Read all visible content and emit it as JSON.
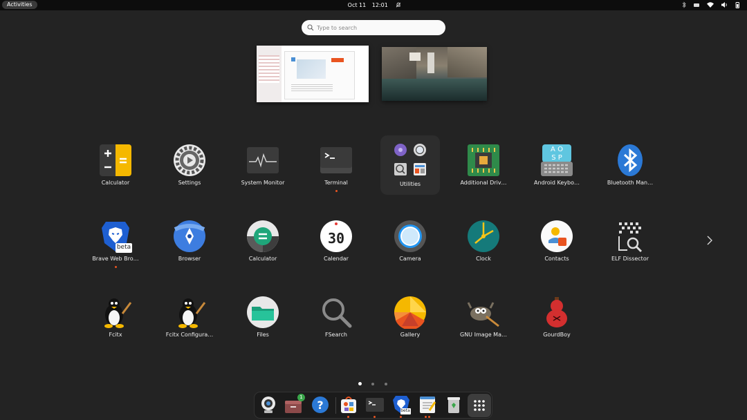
{
  "topbar": {
    "activities": "Activities",
    "date": "Oct 11",
    "time": "12:01"
  },
  "search": {
    "placeholder": "Type to search"
  },
  "apps": [
    {
      "label": "Calculator",
      "icon": "calculator-icon"
    },
    {
      "label": "Settings",
      "icon": "settings-gear-icon"
    },
    {
      "label": "System Monitor",
      "icon": "system-monitor-icon"
    },
    {
      "label": "Terminal",
      "icon": "terminal-icon",
      "running": true
    },
    {
      "label": "Utilities",
      "icon": "utilities-folder-icon"
    },
    {
      "label": "Additional Driv…",
      "icon": "chip-icon"
    },
    {
      "label": "Android Keybo…",
      "icon": "keyboard-icon"
    },
    {
      "label": "Bluetooth Man…",
      "icon": "bluetooth-icon"
    },
    {
      "label": "Brave Web Bro…",
      "icon": "brave-lion-icon",
      "running": true
    },
    {
      "label": "Browser",
      "icon": "browser-compass-icon"
    },
    {
      "label": "Calculator",
      "icon": "calculator-equals-icon"
    },
    {
      "label": "Calendar",
      "icon": "calendar-icon"
    },
    {
      "label": "Camera",
      "icon": "camera-icon"
    },
    {
      "label": "Clock",
      "icon": "clock-icon"
    },
    {
      "label": "Contacts",
      "icon": "contacts-icon"
    },
    {
      "label": "ELF Dissector",
      "icon": "elf-dissector-icon"
    },
    {
      "label": "Fcitx",
      "icon": "tux-penguin-icon"
    },
    {
      "label": "Fcitx Configura…",
      "icon": "tux-penguin-icon"
    },
    {
      "label": "Files",
      "icon": "folder-icon"
    },
    {
      "label": "FSearch",
      "icon": "magnifier-icon"
    },
    {
      "label": "Gallery",
      "icon": "gallery-icon"
    },
    {
      "label": "GNU Image Ma…",
      "icon": "gimp-icon"
    },
    {
      "label": "GourdBoy",
      "icon": "gourd-icon"
    }
  ],
  "calendar_day": "30",
  "brave_badge": "beta",
  "pager": {
    "pages": 3,
    "current": 1
  },
  "dock": {
    "files_badge": "1",
    "brave_badge": "beta",
    "items": [
      "cheese-webcam-icon",
      "files-cabinet-icon",
      "help-icon",
      "app-center-icon",
      "terminal-icon",
      "brave-lion-icon",
      "text-editor-icon",
      "trash-icon",
      "show-apps-grid-icon"
    ]
  },
  "colors": {
    "accent": "#e95420",
    "background": "#232323"
  }
}
